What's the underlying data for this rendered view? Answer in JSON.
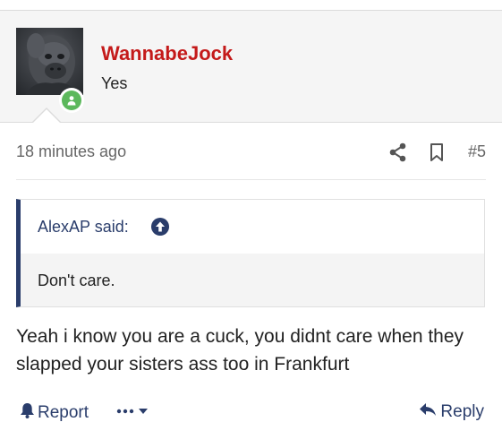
{
  "post": {
    "author": "WannabeJock",
    "user_title": "Yes",
    "timestamp": "18 minutes ago",
    "post_number": "#5",
    "message": "Yeah i know you are a cuck, you didnt care when they slapped your sisters ass too in Frankfurt"
  },
  "quote": {
    "author": "AlexAP said:",
    "text": "Don't care."
  },
  "actions": {
    "report_label": "Report",
    "reply_label": "Reply"
  },
  "icons": {
    "share": "share-icon",
    "bookmark": "bookmark-icon",
    "quote_jump": "arrow-up-circle-icon",
    "report": "bell-icon",
    "more": "ellipsis-dropdown-icon",
    "reply": "reply-arrow-icon",
    "online": "online-user-badge-icon"
  },
  "colors": {
    "username": "#c41a1a",
    "link": "#2a3d6b",
    "online": "#5cb85c",
    "header_bg": "#f5f5f5",
    "quote_bar": "#2a3d6b"
  }
}
